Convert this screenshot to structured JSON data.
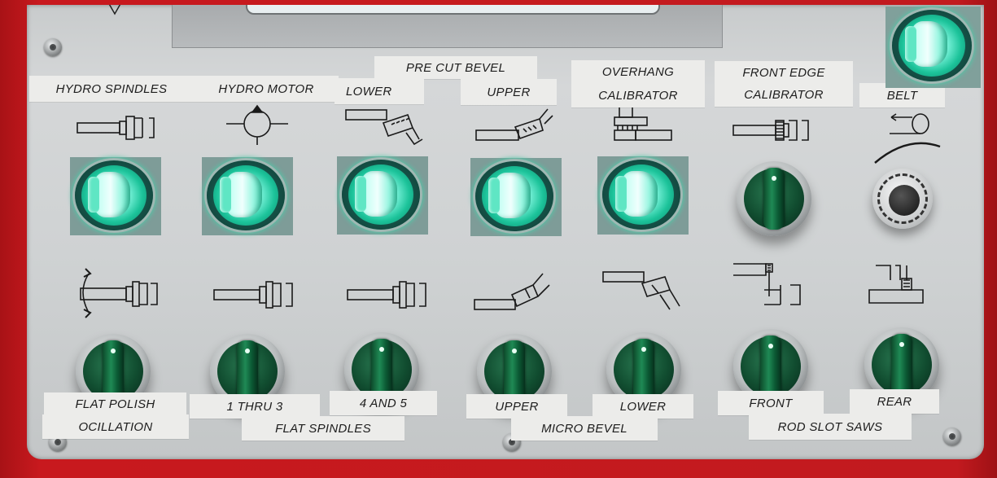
{
  "top_labels": {
    "hydro_spindles": "HYDRO SPINDLES",
    "hydro_motor": "HYDRO MOTOR",
    "pre_cut_bevel": "PRE CUT BEVEL",
    "lower": "LOWER",
    "upper": "UPPER",
    "overhang": "OVERHANG",
    "calibrator_1": "CALIBRATOR",
    "front_edge": "FRONT EDGE",
    "calibrator_2": "CALIBRATOR",
    "belt": "BELT"
  },
  "bottom_labels": {
    "flat_polish": "FLAT POLISH",
    "oscillation": "OCILLATION",
    "thru_3": "1  THRU 3",
    "flat_spindles": "FLAT SPINDLES",
    "four_and_five": "4 AND 5",
    "upper": "UPPER",
    "lower": "LOWER",
    "micro_bevel": "MICRO BEVEL",
    "front": "FRONT",
    "rear": "REAR",
    "rod_slot_saws": "ROD SLOT SAWS"
  },
  "colors": {
    "frame": "#c21a1f",
    "panel": "#d0d3d4",
    "lamp_glow": "#1cc39a",
    "selector_green": "#1f8a55"
  },
  "controls": {
    "illuminated_switches": [
      "hydro-spindles",
      "hydro-motor",
      "pre-cut-bevel-lower",
      "pre-cut-bevel-upper",
      "overhang-calibrator",
      "belt"
    ],
    "selector_switches": [
      "front-edge-calibrator",
      "flat-polish-oscillation",
      "flat-spindles-1-thru-3",
      "flat-spindles-4-and-5",
      "micro-bevel-upper",
      "micro-bevel-lower",
      "rod-slot-saws-front",
      "rod-slot-saws-rear"
    ],
    "speed_dial": "belt-speed-dial"
  }
}
